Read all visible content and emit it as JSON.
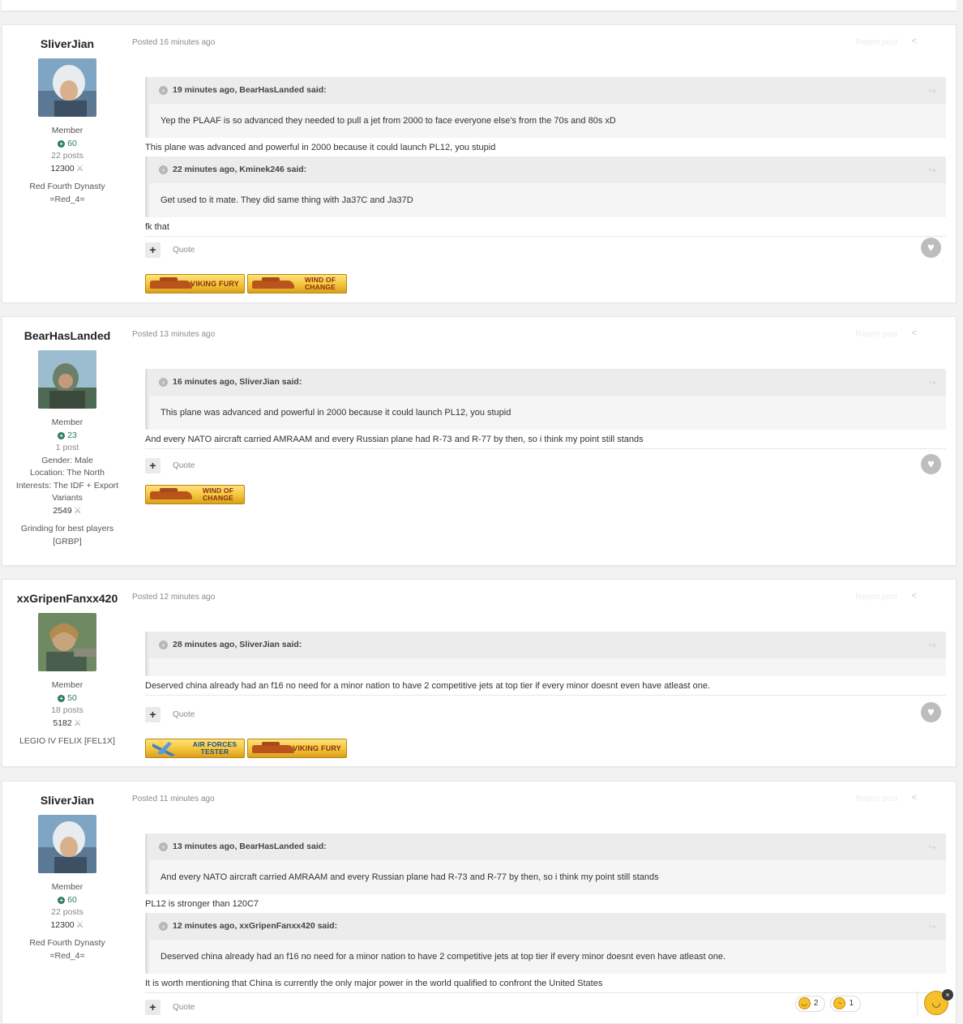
{
  "ui": {
    "plus": "+",
    "heart": "♥",
    "share": "<",
    "arrow": "↪",
    "chevron": "›",
    "score_icon": "⚔",
    "rep_icon": "+"
  },
  "posts": [
    {
      "author": "SliverJian",
      "posted": "Posted 16 minutes ago",
      "faint_action": "Report post",
      "info": [
        "Member"
      ],
      "rep": "60",
      "posts_count": "22 posts",
      "extra": [],
      "score": "12300",
      "clan": [
        "Red Fourth Dynasty",
        "=Red_4="
      ],
      "blocks": [
        {
          "type": "quote",
          "head": "19 minutes ago, BearHasLanded said:",
          "body": "Yep the PLAAF is so advanced they needed to pull a jet from 2000 to face everyone else's from the 70s and 80s xD"
        },
        {
          "type": "reply",
          "text": "This plane was advanced and powerful in 2000 because it could launch PL12, you stupid"
        },
        {
          "type": "quote",
          "head": "22 minutes ago, Kminek246 said:",
          "body": "Get used to it mate. They did same thing with Ja37C and Ja37D"
        },
        {
          "type": "reply",
          "text": "fk that"
        }
      ],
      "quote_label": "Quote",
      "badges": [
        {
          "label": "VIKING FURY",
          "kind": "tank"
        },
        {
          "label": "WIND OF CHANGE",
          "kind": "tank"
        }
      ]
    },
    {
      "author": "BearHasLanded",
      "posted": "Posted 13 minutes ago",
      "faint_action": "Report post",
      "info": [
        "Member"
      ],
      "rep": "23",
      "posts_count": "1 post",
      "extra": [
        "Gender: Male",
        "Location: The North",
        "Interests: The IDF + Export",
        "Variants"
      ],
      "score": "2549",
      "clan": [
        "Grinding for best players",
        "[GRBP]"
      ],
      "blocks": [
        {
          "type": "quote",
          "head": "16 minutes ago, SliverJian said:",
          "body": "This plane was advanced and powerful in 2000 because it could launch PL12, you stupid"
        },
        {
          "type": "reply",
          "text": "And every NATO aircraft carried AMRAAM and every Russian plane had R-73 and R-77 by then, so i think my point still stands"
        }
      ],
      "quote_label": "Quote",
      "badges": [
        {
          "label": "WIND OF CHANGE",
          "kind": "tank"
        }
      ]
    },
    {
      "author": "xxGripenFanxx420",
      "posted": "Posted 12 minutes ago",
      "faint_action": "Report post",
      "info": [
        "Member"
      ],
      "rep": "50",
      "posts_count": "18 posts",
      "extra": [],
      "score": "5182",
      "clan": [
        "LEGIO IV FELIX [FEL1X]"
      ],
      "blocks": [
        {
          "type": "quote",
          "head": "28 minutes ago, SliverJian said:",
          "body": ""
        },
        {
          "type": "reply",
          "text": "Deserved china already had an f16 no need for a minor nation to have 2 competitive jets at top tier if every minor doesnt even have atleast one."
        }
      ],
      "quote_label": "Quote",
      "badges": [
        {
          "label": "AIR FORCES TESTER",
          "kind": "plane"
        },
        {
          "label": "VIKING FURY",
          "kind": "tank"
        }
      ]
    },
    {
      "author": "SliverJian",
      "posted": "Posted 11 minutes ago",
      "faint_action": "Report post",
      "info": [
        "Member"
      ],
      "rep": "60",
      "posts_count": "22 posts",
      "extra": [],
      "score": "12300",
      "clan": [
        "Red Fourth Dynasty",
        "=Red_4="
      ],
      "blocks": [
        {
          "type": "quote",
          "head": "13 minutes ago, BearHasLanded said:",
          "body": "And every NATO aircraft carried AMRAAM and every Russian plane had R-73 and R-77 by then, so i think my point still stands"
        },
        {
          "type": "reply",
          "text": "PL12 is stronger than 120C7"
        },
        {
          "type": "quote",
          "head": "12 minutes ago, xxGripenFanxx420 said:",
          "body": "Deserved china already had an f16 no need for a minor nation to have 2 competitive jets at top tier if every minor doesnt even have atleast one."
        },
        {
          "type": "reply",
          "text": "It is worth mentioning that China is currently the only major power in the world qualified to confront the United States"
        }
      ],
      "quote_label": "Quote",
      "badges": []
    }
  ],
  "reactions": [
    {
      "name": "haha",
      "count": "2"
    },
    {
      "name": "confused",
      "count": "1"
    }
  ],
  "badge_colors": {
    "gold": "#f3c43a",
    "tank": "#b8541c",
    "text": "#8a2e0c"
  },
  "rep_color": "#2a7a5a"
}
